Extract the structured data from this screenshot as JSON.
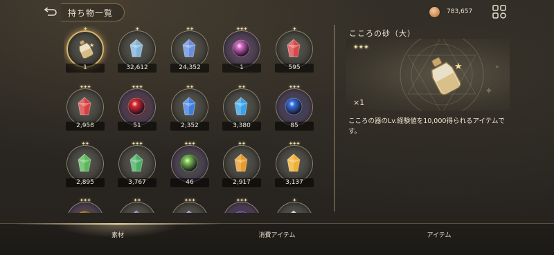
{
  "header": {
    "title": "持ち物一覧",
    "currency_amount": "783,657",
    "back_icon": "back-arrow-icon",
    "menu_icon": "grid-menu-icon"
  },
  "items": [
    {
      "count": "1",
      "stars": "✦",
      "type": "bottle",
      "color": "#c9b07a",
      "selected": true
    },
    {
      "count": "32,612",
      "stars": "✦",
      "type": "crystal",
      "color": "#7fb3d8"
    },
    {
      "count": "24,352",
      "stars": "✦✦",
      "type": "crystal",
      "color": "#6a8fe0"
    },
    {
      "count": "1",
      "stars": "✦✦✦",
      "type": "orb",
      "color": "#d86ac8"
    },
    {
      "count": "595",
      "stars": "✦",
      "type": "crystal",
      "color": "#d94848"
    },
    {
      "count": "2,958",
      "stars": "✦✦✦",
      "type": "crystal",
      "color": "#d84040"
    },
    {
      "count": "51",
      "stars": "✦✦✦",
      "type": "orb",
      "color": "#e02830"
    },
    {
      "count": "2,352",
      "stars": "✦✦",
      "type": "crystal",
      "color": "#3f7fe0"
    },
    {
      "count": "3,380",
      "stars": "✦✦",
      "type": "crystal",
      "color": "#3aa0e8"
    },
    {
      "count": "85",
      "stars": "✦✦✦",
      "type": "orb",
      "color": "#3370e0"
    },
    {
      "count": "2,895",
      "stars": "✦✦",
      "type": "crystal",
      "color": "#5ab85a"
    },
    {
      "count": "3,767",
      "stars": "✦✦✦",
      "type": "crystal",
      "color": "#48b060"
    },
    {
      "count": "46",
      "stars": "✦✦✦",
      "type": "orb",
      "color": "#7ac850"
    },
    {
      "count": "2,917",
      "stars": "✦✦",
      "type": "crystal",
      "color": "#e89a28"
    },
    {
      "count": "3,137",
      "stars": "✦✦✦",
      "type": "crystal",
      "color": "#f0b030"
    },
    {
      "count": "",
      "stars": "✦✦✦",
      "type": "orb",
      "color": "#e8a020"
    },
    {
      "count": "",
      "stars": "✦✦",
      "type": "crystal",
      "color": "#9a6ae0"
    },
    {
      "count": "",
      "stars": "✦✦✦",
      "type": "crystal",
      "color": "#b070e0"
    },
    {
      "count": "",
      "stars": "✦✦✦",
      "type": "orb",
      "color": "#8a48d8"
    },
    {
      "count": "",
      "stars": "✦",
      "type": "crystal",
      "color": "#d0d0d8"
    }
  ],
  "detail": {
    "name": "こころの砂（大）",
    "stars": "✦✦✦",
    "quantity": "×1",
    "description": "こころの器のLv.経験値を10,000得られるアイテムです。"
  },
  "tabs": [
    {
      "label": "素材",
      "active": true
    },
    {
      "label": "消費アイテム",
      "active": false
    },
    {
      "label": "アイテム",
      "active": false
    }
  ]
}
